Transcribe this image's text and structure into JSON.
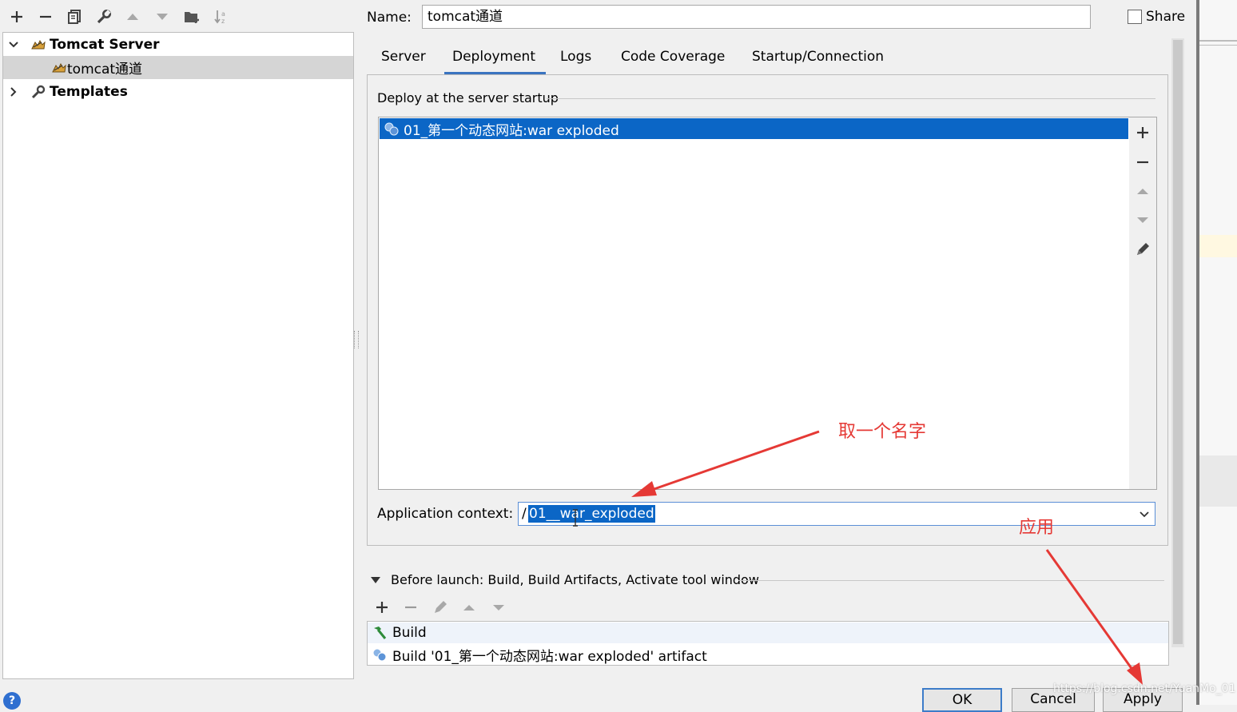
{
  "name_field": {
    "label": "Name:",
    "value": "tomcat通道"
  },
  "share": {
    "label": "Share",
    "checked": false
  },
  "tree": {
    "items": [
      {
        "label": "Tomcat Server",
        "expanded": true
      },
      {
        "label": "tomcat通道",
        "selected": true
      },
      {
        "label": "Templates",
        "expanded": false
      }
    ]
  },
  "tabs": [
    {
      "label": "Server"
    },
    {
      "label": "Deployment",
      "active": true
    },
    {
      "label": "Logs"
    },
    {
      "label": "Code Coverage"
    },
    {
      "label": "Startup/Connection"
    }
  ],
  "deploy": {
    "section_title": "Deploy at the server startup",
    "items": [
      {
        "label": "01_第一个动态网站:war exploded",
        "selected": true
      }
    ]
  },
  "app_context": {
    "label": "Application context:",
    "value": "/01__war_exploded",
    "selected_text": "01__war_exploded"
  },
  "before_launch": {
    "title": "Before launch: Build, Build Artifacts, Activate tool window",
    "items": [
      {
        "label": "Build"
      },
      {
        "label": "Build '01_第一个动态网站:war exploded' artifact"
      }
    ]
  },
  "buttons": {
    "ok": "OK",
    "cancel": "Cancel",
    "apply": "Apply"
  },
  "annotations": {
    "name_hint": "取一个名字",
    "apply_hint": "应用"
  },
  "watermark": "https://blog.csdn.net/YuanMo_01",
  "colors": {
    "selection": "#0b66c6",
    "tab_underline": "#3a74c0",
    "annotation": "#e53935",
    "button_focus": "#3d7cc9"
  }
}
